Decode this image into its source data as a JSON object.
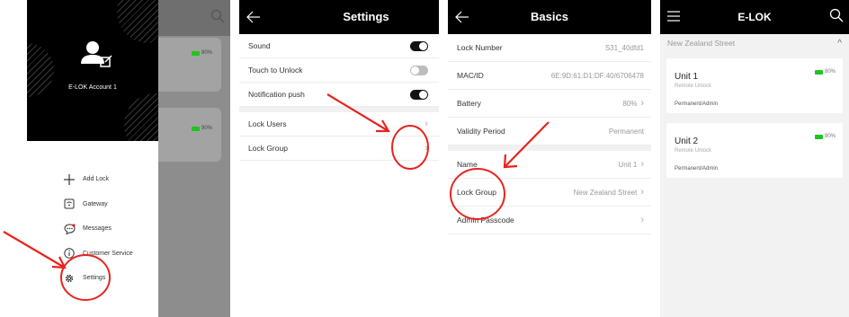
{
  "drawer": {
    "account_name": "E-LOK Account 1",
    "menu": [
      {
        "icon": "plus-icon",
        "label": "Add Lock"
      },
      {
        "icon": "gateway-icon",
        "label": "Gateway"
      },
      {
        "icon": "message-icon",
        "label": "Messages"
      },
      {
        "icon": "info-icon",
        "label": "Customer Service"
      },
      {
        "icon": "gear-icon",
        "label": "Settings"
      }
    ],
    "behind": {
      "battery_1": "80%",
      "battery_2": "90%"
    }
  },
  "settings": {
    "title": "Settings",
    "rows": [
      {
        "label": "Sound",
        "toggle": "on"
      },
      {
        "label": "Touch to Unlock",
        "toggle": "off"
      },
      {
        "label": "Notification push",
        "toggle": "on"
      }
    ],
    "links": [
      {
        "label": "Lock Users"
      },
      {
        "label": "Lock Group"
      }
    ]
  },
  "basics": {
    "title": "Basics",
    "rows": [
      {
        "label": "Lock Number",
        "value": "S31_40dfd1"
      },
      {
        "label": "MAC/ID",
        "value": "6E:9D:61:D1:DF:40/6706478"
      },
      {
        "label": "Battery",
        "value": "80%"
      },
      {
        "label": "Validity Period",
        "value": "Permanent"
      },
      {
        "label": "Name",
        "value": "Unit 1"
      },
      {
        "label": "Lock Group",
        "value": "New Zealand Street"
      },
      {
        "label": "Admin Passcode",
        "value": ""
      }
    ]
  },
  "home": {
    "title": "E-LOK",
    "group_name": "New Zealand Street",
    "units": [
      {
        "name": "Unit 1",
        "subtitle": "Remote Unlock",
        "permission": "Permanent/Admin",
        "battery": "80%"
      },
      {
        "name": "Unit 2",
        "subtitle": "Remote Unlock",
        "permission": "Permanent/Admin",
        "battery": "90%"
      }
    ]
  },
  "colors": {
    "accent": "#000000",
    "battery": "#1ec51e",
    "annotation": "#e8231f"
  }
}
